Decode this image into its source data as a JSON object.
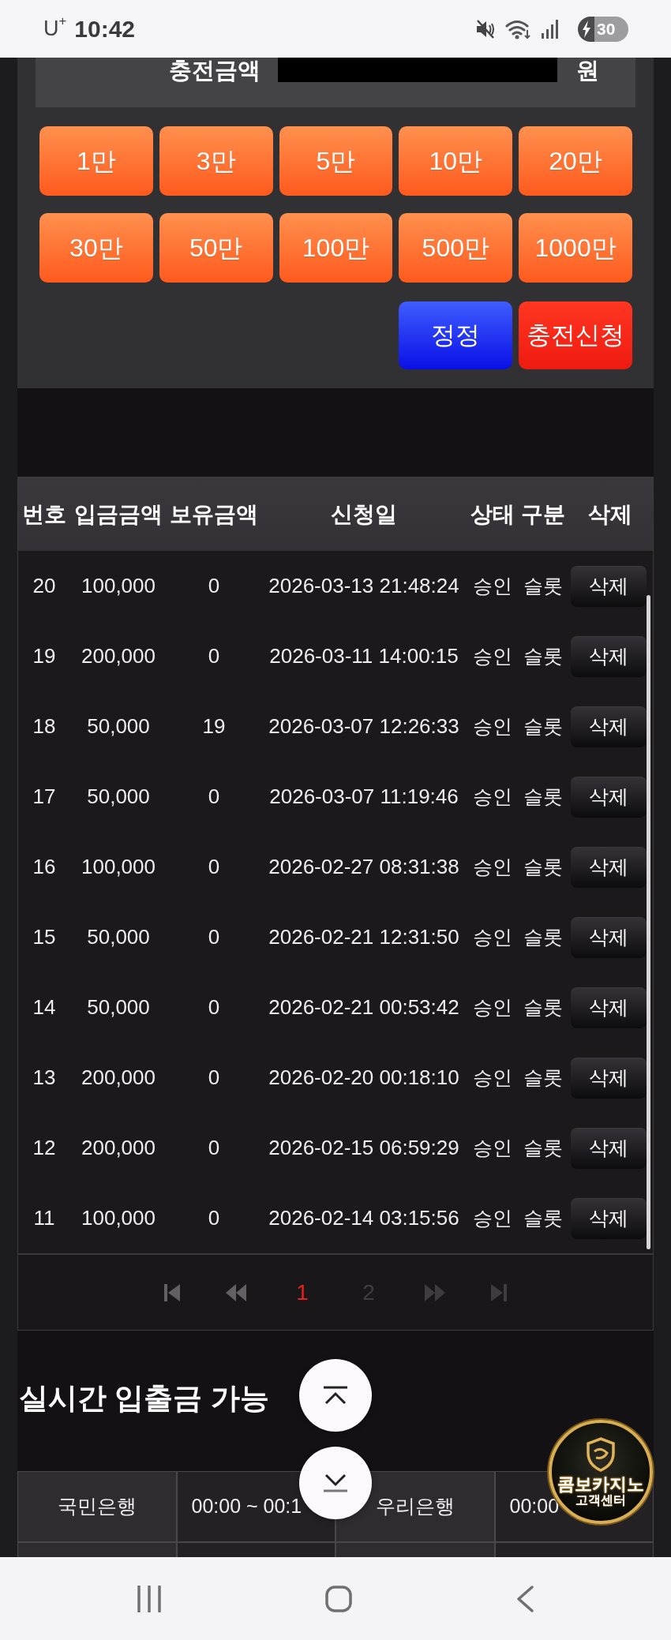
{
  "status_bar": {
    "carrier": "U$^{+}$",
    "time": "10:42",
    "battery": "30"
  },
  "charge_form": {
    "amount_label": "충전금액",
    "unit": "원",
    "quick_amounts": [
      "1만",
      "3만",
      "5만",
      "10만",
      "20만",
      "30만",
      "50만",
      "100만",
      "500만",
      "1000만"
    ],
    "actions": [
      {
        "label": "정정",
        "kind": "reset"
      },
      {
        "label": "충전신청",
        "kind": "submit"
      }
    ]
  },
  "history_table": {
    "columns": [
      "번호",
      "입금금액",
      "보유금액",
      "신청일",
      "상태",
      "구분",
      "삭제"
    ],
    "rows": [
      {
        "no": "20",
        "deposit": "100,000",
        "balance": "0",
        "requested_at": "2026-03-13 21:48:24",
        "status": "승인",
        "category": "슬롯",
        "action": "삭제"
      },
      {
        "no": "19",
        "deposit": "200,000",
        "balance": "0",
        "requested_at": "2026-03-11 14:00:15",
        "status": "승인",
        "category": "슬롯",
        "action": "삭제"
      },
      {
        "no": "18",
        "deposit": "50,000",
        "balance": "19",
        "requested_at": "2026-03-07 12:26:33",
        "status": "승인",
        "category": "슬롯",
        "action": "삭제"
      },
      {
        "no": "17",
        "deposit": "50,000",
        "balance": "0",
        "requested_at": "2026-03-07 11:19:46",
        "status": "승인",
        "category": "슬롯",
        "action": "삭제"
      },
      {
        "no": "16",
        "deposit": "100,000",
        "balance": "0",
        "requested_at": "2026-02-27 08:31:38",
        "status": "승인",
        "category": "슬롯",
        "action": "삭제"
      },
      {
        "no": "15",
        "deposit": "50,000",
        "balance": "0",
        "requested_at": "2026-02-21 12:31:50",
        "status": "승인",
        "category": "슬롯",
        "action": "삭제"
      },
      {
        "no": "14",
        "deposit": "50,000",
        "balance": "0",
        "requested_at": "2026-02-21 00:53:42",
        "status": "승인",
        "category": "슬롯",
        "action": "삭제"
      },
      {
        "no": "13",
        "deposit": "200,000",
        "balance": "0",
        "requested_at": "2026-02-20 00:18:10",
        "status": "승인",
        "category": "슬롯",
        "action": "삭제"
      },
      {
        "no": "12",
        "deposit": "200,000",
        "balance": "0",
        "requested_at": "2026-02-15 06:59:29",
        "status": "승인",
        "category": "슬롯",
        "action": "삭제"
      },
      {
        "no": "11",
        "deposit": "100,000",
        "balance": "0",
        "requested_at": "2026-02-14 03:15:56",
        "status": "승인",
        "category": "슬롯",
        "action": "삭제"
      }
    ]
  },
  "pagination": {
    "controls": [
      {
        "kind": "first",
        "disabled": false
      },
      {
        "kind": "prev",
        "disabled": false
      },
      {
        "kind": "next",
        "disabled": true
      },
      {
        "kind": "last",
        "disabled": true
      }
    ],
    "pages": [
      {
        "label": "1",
        "selected": true
      },
      {
        "label": "2",
        "selected": false
      }
    ]
  },
  "availability": {
    "title": "실시간 입출금 가능",
    "rows": [
      [
        {
          "kind": "bank",
          "text": "국민은행"
        },
        {
          "kind": "time",
          "text": "00:00 ~ 00:1"
        },
        {
          "kind": "bank",
          "text": "우리은행"
        },
        {
          "kind": "time",
          "text": "00:00"
        }
      ]
    ]
  },
  "scroll_buttons": [
    {
      "kind": "top"
    },
    {
      "kind": "bottom"
    }
  ],
  "support_badge": {
    "title": "콤보카지노",
    "subtitle": "고객센터"
  }
}
